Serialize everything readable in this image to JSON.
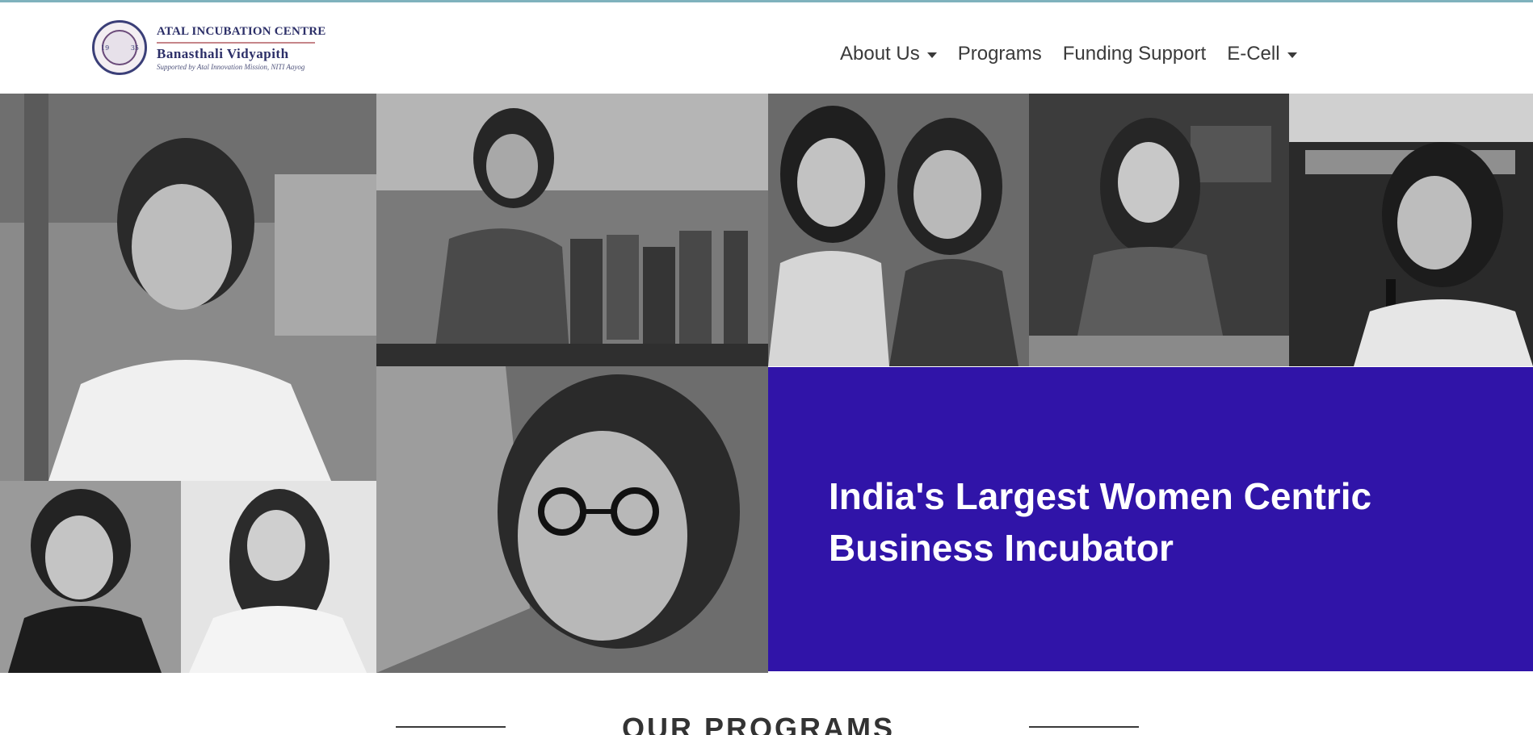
{
  "brand": {
    "title": "ATAL INCUBATION CENTRE",
    "subtitle": "Banasthali Vidyapith",
    "tagline": "Supported by Atal Innovation Mission, NITI Aayog",
    "seal_year_left": "19",
    "seal_year_right": "35"
  },
  "nav": {
    "items": [
      {
        "label": "About Us",
        "dropdown": true
      },
      {
        "label": "Programs",
        "dropdown": false
      },
      {
        "label": "Funding Support",
        "dropdown": false
      },
      {
        "label": "E-Cell",
        "dropdown": true
      }
    ]
  },
  "hero": {
    "headline": "India's Largest Women Centric Business Incubator",
    "box_color": "#3014a8"
  },
  "photos": {
    "style": "black-and-white portraits",
    "count": 8
  },
  "programs": {
    "heading": "OUR PROGRAMS"
  },
  "colors": {
    "brand_navy": "#2c2f68",
    "accent_purple": "#3014a8",
    "nav_text": "#3a3a3a"
  }
}
